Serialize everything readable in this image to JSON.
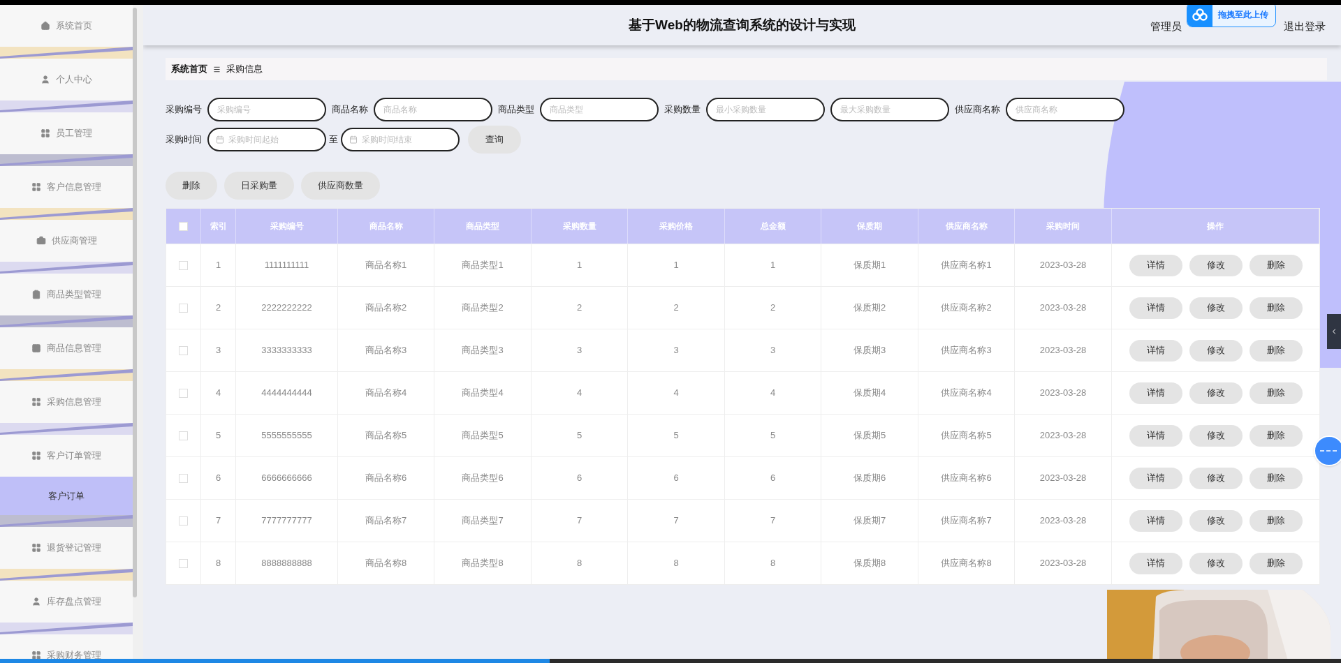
{
  "sidebar": {
    "items": [
      {
        "label": "系统首页",
        "selected": false
      },
      {
        "label": "个人中心",
        "selected": false
      },
      {
        "label": "员工管理",
        "selected": false
      },
      {
        "label": "客户信息管理",
        "selected": false
      },
      {
        "label": "供应商管理",
        "selected": false
      },
      {
        "label": "商品类型管理",
        "selected": false
      },
      {
        "label": "商品信息管理",
        "selected": false
      },
      {
        "label": "采购信息管理",
        "selected": false
      },
      {
        "label": "客户订单管理",
        "selected": false,
        "expanded": true,
        "children": [
          {
            "label": "客户订单",
            "selected": true
          }
        ]
      },
      {
        "label": "退货登记管理",
        "selected": false
      },
      {
        "label": "库存盘点管理",
        "selected": false
      },
      {
        "label": "采购财务管理",
        "selected": false
      }
    ]
  },
  "header": {
    "title": "基于Web的物流查询系统的设计与实现",
    "user_role": "管理员",
    "logout": "退出登录",
    "upload_widget": "拖拽至此上传"
  },
  "breadcrumb": [
    "系统首页",
    "采购信息"
  ],
  "filters": [
    {
      "label": "采购编号",
      "fields": [
        {
          "placeholder": "采购编号"
        }
      ]
    },
    {
      "label": "商品名称",
      "fields": [
        {
          "placeholder": "商品名称"
        }
      ]
    },
    {
      "label": "商品类型",
      "fields": [
        {
          "placeholder": "商品类型"
        }
      ]
    },
    {
      "label": "采购数量",
      "fields": [
        {
          "placeholder": "最小采购数量"
        },
        {
          "placeholder": "最大采购数量"
        }
      ]
    },
    {
      "label": "供应商名称",
      "fields": [
        {
          "placeholder": "供应商名称"
        }
      ]
    }
  ],
  "date_filter": {
    "label": "采购时间",
    "start_placeholder": "采购时间起始",
    "separator": "至",
    "end_placeholder": "采购时间结束"
  },
  "search_button": "查询",
  "action_buttons": [
    "删除",
    "日采购量",
    "供应商数量"
  ],
  "table": {
    "select_all_checked": false,
    "columns": [
      "索引",
      "采购编号",
      "商品名称",
      "商品类型",
      "采购数量",
      "采购价格",
      "总金额",
      "保质期",
      "供应商名称",
      "采购时间",
      "操作"
    ],
    "rows": [
      {
        "checked": false,
        "cells": [
          "1",
          "1111111111",
          "商品名称1",
          "商品类型1",
          "1",
          "1",
          "1",
          "保质期1",
          "供应商名称1",
          "2023-03-28"
        ],
        "actions": [
          "详情",
          "修改",
          "删除"
        ]
      },
      {
        "checked": false,
        "cells": [
          "2",
          "2222222222",
          "商品名称2",
          "商品类型2",
          "2",
          "2",
          "2",
          "保质期2",
          "供应商名称2",
          "2023-03-28"
        ],
        "actions": [
          "详情",
          "修改",
          "删除"
        ]
      },
      {
        "checked": false,
        "cells": [
          "3",
          "3333333333",
          "商品名称3",
          "商品类型3",
          "3",
          "3",
          "3",
          "保质期3",
          "供应商名称3",
          "2023-03-28"
        ],
        "actions": [
          "详情",
          "修改",
          "删除"
        ]
      },
      {
        "checked": false,
        "cells": [
          "4",
          "4444444444",
          "商品名称4",
          "商品类型4",
          "4",
          "4",
          "4",
          "保质期4",
          "供应商名称4",
          "2023-03-28"
        ],
        "actions": [
          "详情",
          "修改",
          "删除"
        ]
      },
      {
        "checked": false,
        "cells": [
          "5",
          "5555555555",
          "商品名称5",
          "商品类型5",
          "5",
          "5",
          "5",
          "保质期5",
          "供应商名称5",
          "2023-03-28"
        ],
        "actions": [
          "详情",
          "修改",
          "删除"
        ]
      },
      {
        "checked": false,
        "cells": [
          "6",
          "6666666666",
          "商品名称6",
          "商品类型6",
          "6",
          "6",
          "6",
          "保质期6",
          "供应商名称6",
          "2023-03-28"
        ],
        "actions": [
          "详情",
          "修改",
          "删除"
        ]
      },
      {
        "checked": false,
        "cells": [
          "7",
          "7777777777",
          "商品名称7",
          "商品类型7",
          "7",
          "7",
          "7",
          "保质期7",
          "供应商名称7",
          "2023-03-28"
        ],
        "actions": [
          "详情",
          "修改",
          "删除"
        ]
      },
      {
        "checked": false,
        "cells": [
          "8",
          "8888888888",
          "商品名称8",
          "商品类型8",
          "8",
          "8",
          "8",
          "保质期8",
          "供应商名称8",
          "2023-03-28"
        ],
        "actions": [
          "详情",
          "修改",
          "删除"
        ]
      }
    ]
  },
  "progress": {
    "level": 0.41
  }
}
